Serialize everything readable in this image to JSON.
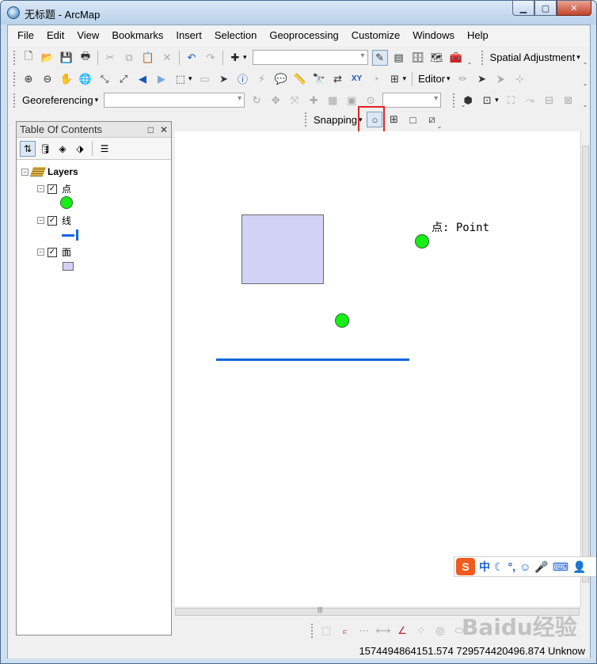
{
  "window": {
    "title": "无标题 - ArcMap",
    "min_glyph": "▁",
    "max_glyph": "▢",
    "close_glyph": "✕"
  },
  "menu": [
    "File",
    "Edit",
    "View",
    "Bookmarks",
    "Insert",
    "Selection",
    "Geoprocessing",
    "Customize",
    "Windows",
    "Help"
  ],
  "toolbars": {
    "spatial_adjustment": "Spatial Adjustment",
    "editor": "Editor",
    "georeferencing": "Georeferencing",
    "snapping": "Snapping",
    "dropdown_glyph": "▾"
  },
  "toc": {
    "title": "Table Of Contents",
    "pin_glyph": "□",
    "close_glyph": "✕",
    "root_label": "Layers",
    "layers": [
      {
        "name": "点",
        "checked": true,
        "symbol": "point"
      },
      {
        "name": "线",
        "checked": true,
        "symbol": "line"
      },
      {
        "name": "面",
        "checked": true,
        "symbol": "polygon"
      }
    ],
    "expand_glyph": "−",
    "check_glyph": "✓"
  },
  "map": {
    "label": "点: Point",
    "point_color": "#16ef16",
    "line_color": "#1166dd",
    "polygon_fill": "#d2d2f6"
  },
  "status": {
    "coordinates": "1574494864151.574  729574420496.874 Unknow"
  },
  "ime": {
    "logo": "S",
    "mode": "中",
    "items": [
      "☾",
      "°,",
      "☺",
      "🎤",
      "⌨",
      "👤"
    ]
  },
  "watermark": "Baidu经验",
  "colors": {
    "highlight_box": "#e02424",
    "titlebar": "#b9d1ea"
  }
}
